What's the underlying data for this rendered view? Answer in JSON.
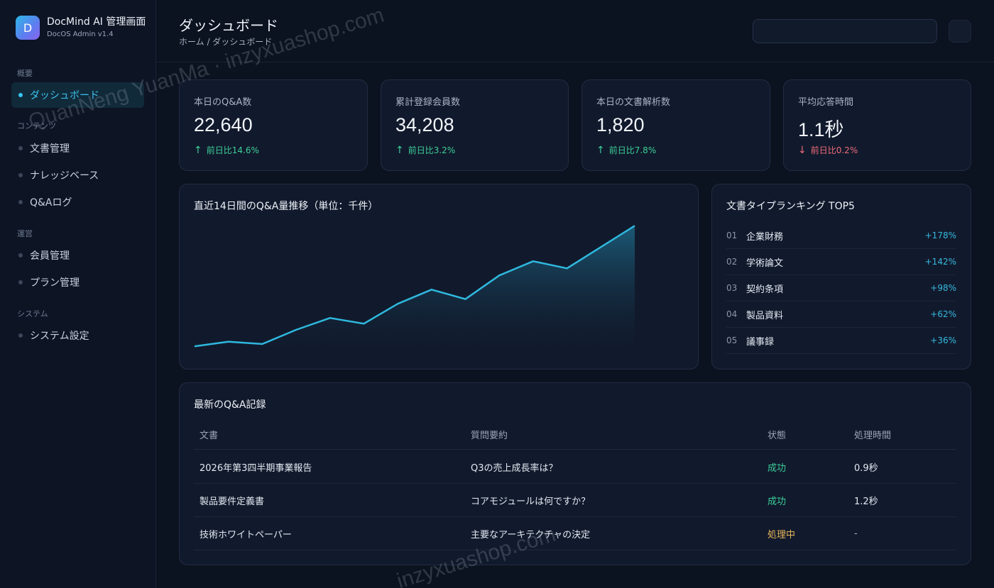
{
  "brand": {
    "logo_letter": "D",
    "title": "DocMind AI 管理画面",
    "subtitle": "DocOS Admin v1.4"
  },
  "sidebar": {
    "sections": [
      {
        "label": "概要",
        "items": [
          {
            "label": "ダッシュボード",
            "active": true
          }
        ]
      },
      {
        "label": "コンテンツ",
        "items": [
          {
            "label": "文書管理"
          },
          {
            "label": "ナレッジベース"
          },
          {
            "label": "Q&Aログ"
          }
        ]
      },
      {
        "label": "運営",
        "items": [
          {
            "label": "会員管理"
          },
          {
            "label": "プラン管理"
          }
        ]
      },
      {
        "label": "システム",
        "items": [
          {
            "label": "システム設定"
          }
        ]
      }
    ]
  },
  "header": {
    "title": "ダッシュボード",
    "breadcrumb": "ホーム / ダッシュボード",
    "search_value": ""
  },
  "stats": [
    {
      "label": "本日のQ&A数",
      "value": "22,640",
      "trend": "前日比14.6%",
      "direction": "up",
      "arrow": "↑"
    },
    {
      "label": "累計登録会員数",
      "value": "34,208",
      "trend": "前日比3.2%",
      "direction": "up",
      "arrow": "↑"
    },
    {
      "label": "本日の文書解析数",
      "value": "1,820",
      "trend": "前日比7.8%",
      "direction": "up",
      "arrow": "↑"
    },
    {
      "label": "平均応答時間",
      "value": "1.1秒",
      "trend": "前日比0.2%",
      "direction": "down",
      "arrow": "↓"
    }
  ],
  "trend_chart": {
    "title": "直近14日間のQ&A量推移（単位：千件）",
    "chart_data": {
      "type": "area",
      "x": [
        1,
        2,
        3,
        4,
        5,
        6,
        7,
        8,
        9,
        10,
        11,
        12,
        13,
        14
      ],
      "values": [
        1.0,
        2.0,
        1.5,
        4.5,
        7.0,
        5.8,
        10.0,
        13.0,
        11.0,
        16.0,
        19.0,
        17.5,
        22.0,
        26.5
      ],
      "ylim": [
        0,
        27
      ],
      "grid": false,
      "line_color": "#2fb8de"
    }
  },
  "ranking": {
    "title": "文書タイプランキング TOP5",
    "items": [
      {
        "no": "01",
        "name": "企業財務",
        "pct": "+178%"
      },
      {
        "no": "02",
        "name": "学術論文",
        "pct": "+142%"
      },
      {
        "no": "03",
        "name": "契約条項",
        "pct": "+98%"
      },
      {
        "no": "04",
        "name": "製品資料",
        "pct": "+62%"
      },
      {
        "no": "05",
        "name": "議事録",
        "pct": "+36%"
      }
    ]
  },
  "records": {
    "title": "最新のQ&A記録",
    "columns": [
      "文書",
      "質問要約",
      "状態",
      "処理時間"
    ],
    "rows": [
      {
        "doc": "2026年第3四半期事業報告",
        "question": "Q3の売上成長率は？",
        "status": "成功",
        "status_kind": "ok",
        "time": "0.9秒"
      },
      {
        "doc": "製品要件定義書",
        "question": "コアモジュールは何ですか？",
        "status": "成功",
        "status_kind": "ok",
        "time": "1.2秒"
      },
      {
        "doc": "技術ホワイトペーパー",
        "question": "主要なアーキテクチャの決定",
        "status": "処理中",
        "status_kind": "proc",
        "time": "-"
      }
    ]
  },
  "watermarks": [
    "QuanNeng YuanMa · inzyxuashop.com",
    "inzyxuashop.com"
  ],
  "colors": {
    "accent": "#38c6f0",
    "up": "#3ccf9a",
    "down": "#ef6b7a",
    "processing": "#e8b55a"
  }
}
